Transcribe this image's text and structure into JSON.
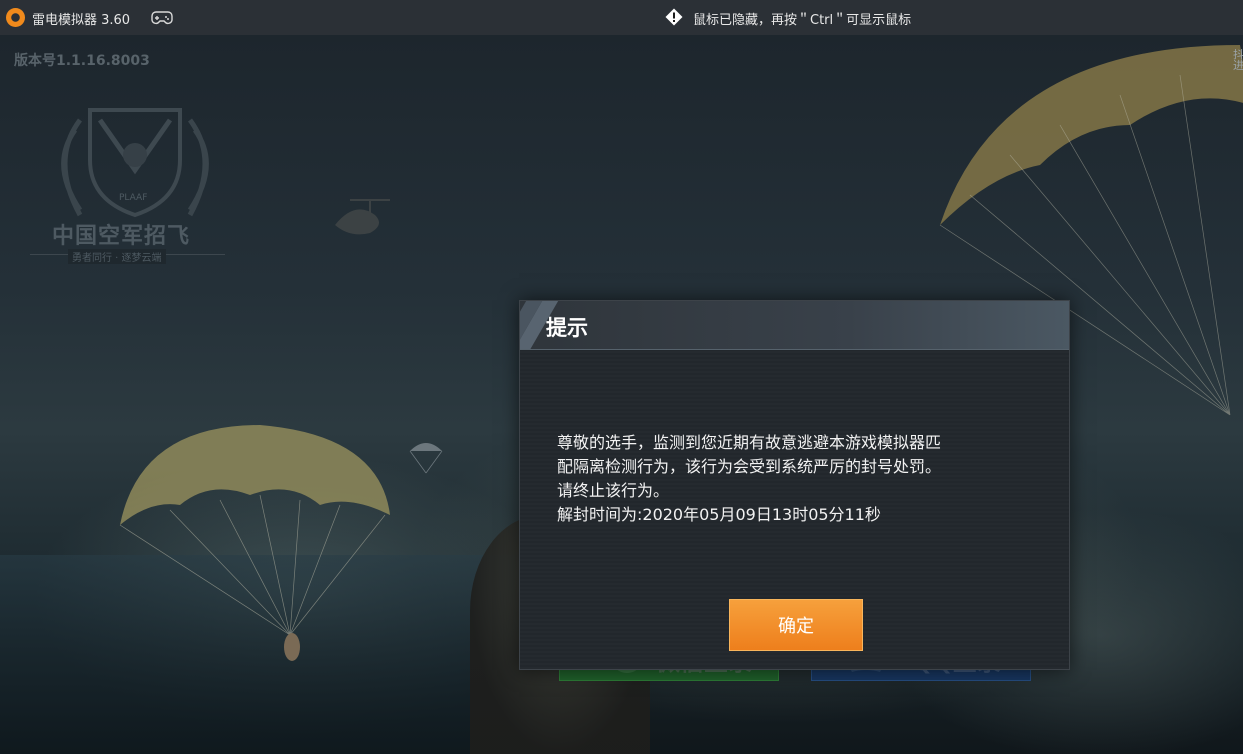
{
  "titlebar": {
    "app_name": "雷电模拟器 3.60",
    "mouse_hint": "鼠标已隐藏，再按＂Ctrl＂可显示鼠标"
  },
  "game": {
    "version": "版本号1.1.16.8003",
    "emblem": {
      "badge_text": "PLAAF",
      "title": "中国空军招飞",
      "subtitle": "勇者同行 · 逐梦云端"
    },
    "login_wechat_label": "微信登录",
    "login_qq_label": "QQ登录",
    "right_edge_text": "抖进"
  },
  "dialog": {
    "title": "提示",
    "body_lines": [
      "尊敬的选手，监测到您近期有故意逃避本游戏模拟器匹",
      "配隔离检测行为，该行为会受到系统严厉的封号处罚。",
      "请终止该行为。",
      "解封时间为:2020年05月09日13时05分11秒"
    ],
    "confirm_label": "确定"
  },
  "colors": {
    "accent_orange": "#ee7f1c",
    "titlebar_bg": "#2b3036",
    "dialog_bg": "#22272c"
  }
}
